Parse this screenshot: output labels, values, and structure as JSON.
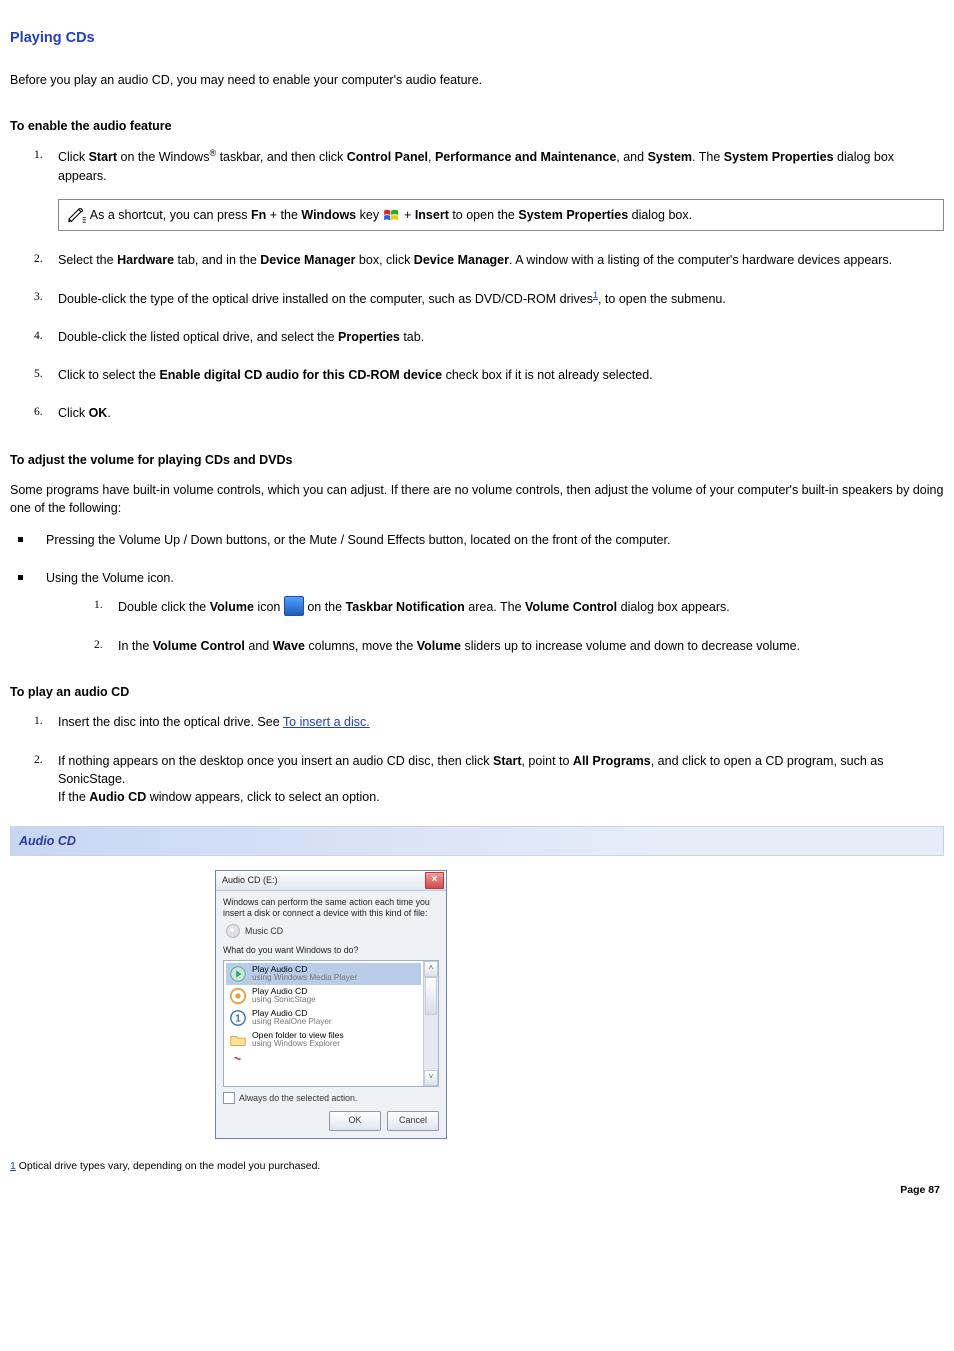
{
  "title": "Playing CDs",
  "intro": "Before you play an audio CD, you may need to enable your computer's audio feature.",
  "sec_enable": {
    "heading": "To enable the audio feature",
    "items": {
      "n1a": "Click ",
      "n1b": "Start",
      "n1c": " on the Windows",
      "n1c_reg": "®",
      "n1d": " taskbar, and then click ",
      "n1e": "Control Panel",
      "n1f": ", ",
      "n1g": "Performance and Maintenance",
      "n1h": ", and ",
      "n1i": "System",
      "n1j": ". The ",
      "n1k": "System Properties",
      "n1l": " dialog box appears.",
      "tip_a": "As a shortcut, you can press ",
      "tip_b": "Fn",
      "tip_c": " + the ",
      "tip_d": "Windows",
      "tip_e": " key ",
      "tip_f": " + ",
      "tip_g": "Insert",
      "tip_h": " to open the ",
      "tip_i": "System Properties",
      "tip_j": " dialog box.",
      "n2a": "Select the ",
      "n2b": "Hardware",
      "n2c": " tab, and in the ",
      "n2d": "Device Manager",
      "n2e": " box, click ",
      "n2f": "Device Manager",
      "n2g": ". A window with a listing of the computer's hardware devices appears.",
      "n3a": "Double-click the type of the optical drive installed on the computer, such as DVD/CD-ROM drives",
      "n3b": ", to open the submenu.",
      "fnref": "1",
      "n4a": "Double-click the listed optical drive, and select the ",
      "n4b": "Properties",
      "n4c": " tab.",
      "n5a": "Click to select the ",
      "n5b": "Enable digital CD audio for this CD-ROM device",
      "n5c": " check box if it is not already selected.",
      "n6a": "Click ",
      "n6b": "OK",
      "n6c": "."
    }
  },
  "sec_volume": {
    "heading": "To adjust the volume for playing CDs and DVDs",
    "intro": "Some programs have built-in volume controls, which you can adjust. If there are no volume controls, then adjust the volume of your computer's built-in speakers by doing one of the following:",
    "b1": "Pressing the Volume Up / Down buttons, or the Mute / Sound Effects button, located on the front of the computer.",
    "b2": "Using the Volume icon.",
    "s1a": "Double click the ",
    "s1b": "Volume",
    "s1c": " icon ",
    "s1d": " on the ",
    "s1e": "Taskbar Notification",
    "s1f": " area. The ",
    "s1g": "Volume Control",
    "s1h": " dialog box appears.",
    "s2a": "In the ",
    "s2b": "Volume Control",
    "s2c": " and ",
    "s2d": "Wave",
    "s2e": " columns, move the ",
    "s2f": "Volume",
    "s2g": " sliders up to increase volume and down to decrease volume."
  },
  "sec_play": {
    "heading": "To play an audio CD",
    "n1a": "Insert the disc into the optical drive. See ",
    "n1link": "To insert a disc.",
    "n2a": "If nothing appears on the desktop once you insert an audio CD disc, then click ",
    "n2b": "Start",
    "n2c": ", point to ",
    "n2d": "All Programs",
    "n2e": ", and click to open a CD program, such as SonicStage.",
    "n2f": "If the ",
    "n2g": "Audio CD",
    "n2h": " window appears, click to select an option."
  },
  "caption": "Audio CD",
  "dialog": {
    "title": "Audio CD (E:)",
    "close": "×",
    "desc": "Windows can perform the same action each time you insert a disk or connect a device with this kind of file:",
    "kind": "Music CD",
    "question": "What do you want Windows to do?",
    "items": [
      {
        "l1": "Play Audio CD",
        "l2": "using Windows Media Player"
      },
      {
        "l1": "Play Audio CD",
        "l2": "using SonicStage"
      },
      {
        "l1": "Play Audio CD",
        "l2": "using RealOne Player"
      },
      {
        "l1": "Open folder to view files",
        "l2": "using Windows Explorer"
      }
    ],
    "always": "Always do the selected action.",
    "ok": "OK",
    "cancel": "Cancel",
    "sb_up": "˄",
    "sb_dn": "˅"
  },
  "footnote": {
    "mark": "1",
    "text": " Optical drive types vary, depending on the model you purchased."
  },
  "page_number": "Page 87"
}
